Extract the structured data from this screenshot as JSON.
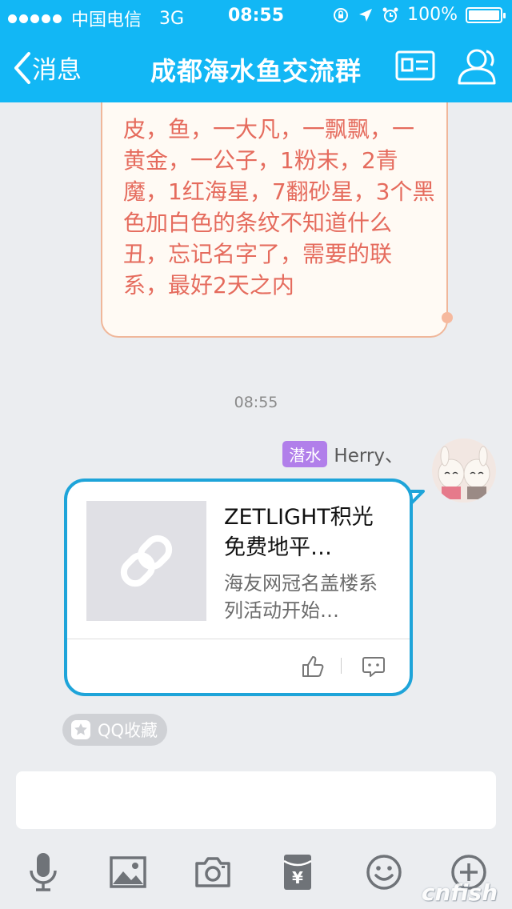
{
  "status_bar": {
    "carrier": "中国电信",
    "network": "3G",
    "time": "08:55",
    "battery": "100%"
  },
  "nav": {
    "back_label": "消息",
    "title": "成都海水鱼交流群",
    "accent_color": "#12b7f5"
  },
  "messages": {
    "previous_text": "皮，鱼，一大凡，一飘飘，一黄金，一公子，1粉末，2青魔，1红海星，7翻砂星，3个黑色加白色的条纹不知道什么丑，忘记名字了，需要的联系，最好2天之内",
    "timestamp": "08:55",
    "sender_badge": "潜水",
    "sender_name": "Herry、",
    "card": {
      "title": "ZETLIGHT积光免费地平…",
      "description": "海友网冠名盖楼系列活动开始…",
      "thumbnail_icon": "link-icon",
      "like_icon": "thumbs-up-icon",
      "comment_icon": "comment-icon"
    },
    "favorite_chip": "QQ收藏"
  },
  "input": {
    "value": ""
  },
  "toolbar": {
    "icons": [
      "microphone-icon",
      "image-icon",
      "camera-icon",
      "red-packet-icon",
      "emoji-icon",
      "plus-icon"
    ]
  },
  "watermark": "cnfish"
}
